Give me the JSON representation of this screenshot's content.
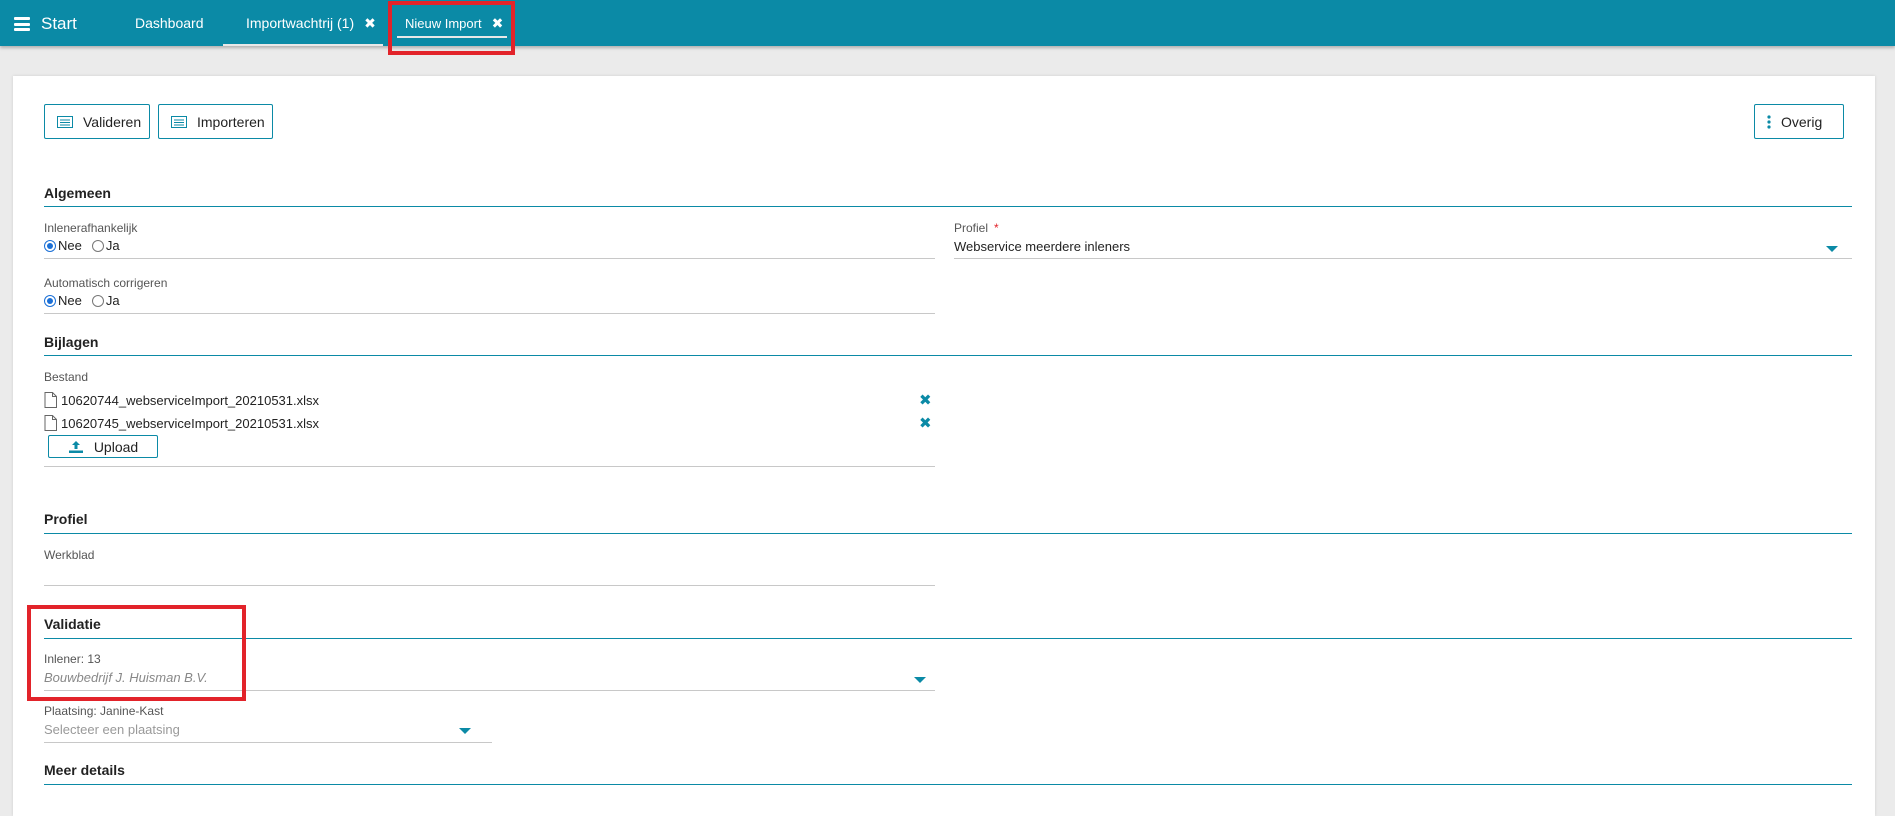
{
  "topbar": {
    "start_label": "Start",
    "tabs": [
      {
        "label": "Dashboard"
      },
      {
        "label": "Importwachtrij (1)"
      },
      {
        "label": "Nieuw Import"
      }
    ]
  },
  "toolbar": {
    "validate_label": "Valideren",
    "import_label": "Importeren",
    "more_label": "Overig"
  },
  "sections": {
    "algemeen": {
      "title": "Algemeen",
      "inlener_label": "Inlenerafhankelijk",
      "inlener_options": [
        "Nee",
        "Ja"
      ],
      "auto_label": "Automatisch corrigeren",
      "auto_options": [
        "Nee",
        "Ja"
      ],
      "profiel_label": "Profiel",
      "profiel_required": "*",
      "profiel_value": "Webservice meerdere inleners"
    },
    "bijlagen": {
      "title": "Bijlagen",
      "bestand_label": "Bestand",
      "files": [
        "10620744_webserviceImport_20210531.xlsx",
        "10620745_webserviceImport_20210531.xlsx"
      ],
      "upload_label": "Upload"
    },
    "profiel": {
      "title": "Profiel",
      "werkblad_label": "Werkblad"
    },
    "validatie": {
      "title": "Validatie",
      "inlener_label": "Inlener: 13",
      "inlener_value": "Bouwbedrijf J. Huisman B.V.",
      "plaatsing_label": "Plaatsing: Janine-Kast",
      "plaatsing_placeholder": "Selecteer een plaatsing"
    },
    "meer": {
      "title": "Meer details"
    }
  },
  "colors": {
    "accent": "#0b8aa6",
    "highlight": "#e2232a"
  }
}
